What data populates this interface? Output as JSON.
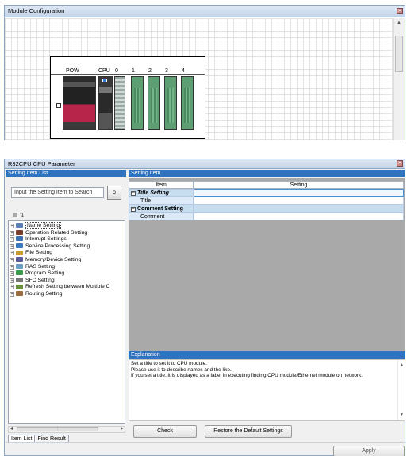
{
  "module_config": {
    "title": "Module Configuration",
    "close_glyph": "✕",
    "slot_labels": [
      "POW",
      "CPU",
      "0",
      "1",
      "2",
      "3",
      "4"
    ]
  },
  "cpu_param": {
    "title": "R32CPU CPU Parameter",
    "close_glyph": "✕",
    "left_pane": {
      "header": "Setting Item List",
      "search_placeholder": "Input the Setting Item to Search",
      "tree_items": [
        "Name Setting",
        "Operation Related Setting",
        "Interrupt Settings",
        "Service Processing Setting",
        "File Setting",
        "Memory/Device Setting",
        "RAS Setting",
        "Program Setting",
        "SFC Setting",
        "Refresh Setting between Multiple C",
        "Routing Setting"
      ],
      "tree_icon_colors": [
        "#5a7fb8",
        "#7a3d2a",
        "#3a6fb0",
        "#3a7ac0",
        "#c89a2e",
        "#5b5b9a",
        "#6aa0c8",
        "#3c9a4c",
        "#777777",
        "#6a8f3a",
        "#9a6a3a"
      ],
      "tabs": [
        "Item List",
        "Find Result"
      ]
    },
    "right_pane": {
      "header": "Setting Item",
      "columns": [
        "Item",
        "Setting"
      ],
      "rows": [
        {
          "label": "Title Setting",
          "type": "group"
        },
        {
          "label": "Title",
          "type": "child"
        },
        {
          "label": "Comment Setting",
          "type": "group"
        },
        {
          "label": "Comment",
          "type": "child"
        }
      ],
      "explanation_header": "Explanation",
      "explanation_lines": [
        "Set a title to set it to CPU module.",
        "Please use it to describe names and the like.",
        "If you set a title, it is displayed as a label in executing finding CPU module/Ethernet module on network."
      ],
      "buttons": {
        "check": "Check",
        "restore": "Restore the Default Settings",
        "apply": "Apply"
      }
    }
  }
}
